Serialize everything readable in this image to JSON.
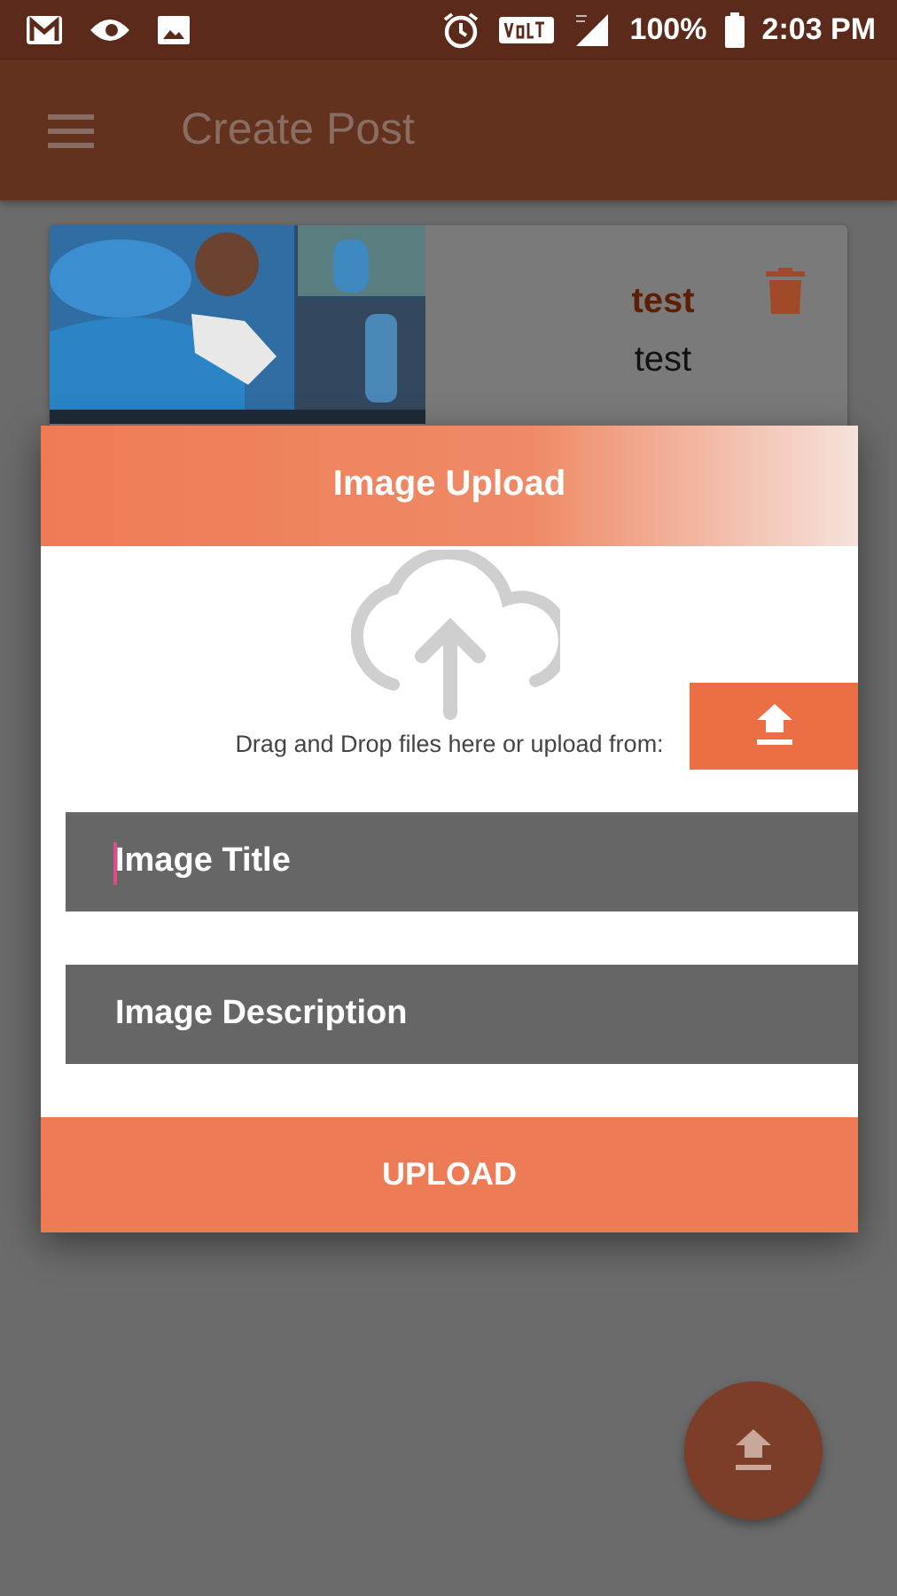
{
  "status_bar": {
    "battery": "100%",
    "time": "2:03 PM"
  },
  "toolbar": {
    "title": "Create Post"
  },
  "posts": [
    {
      "kind": "picture",
      "title": "test",
      "description": "test"
    }
  ],
  "dialog": {
    "title": "Image Upload",
    "hint": "Drag and Drop files here or upload from:",
    "fields": [
      {
        "placeholder": "Image Title",
        "focused": true
      },
      {
        "placeholder": "Image Description",
        "focused": false
      }
    ],
    "button": "UPLOAD"
  }
}
